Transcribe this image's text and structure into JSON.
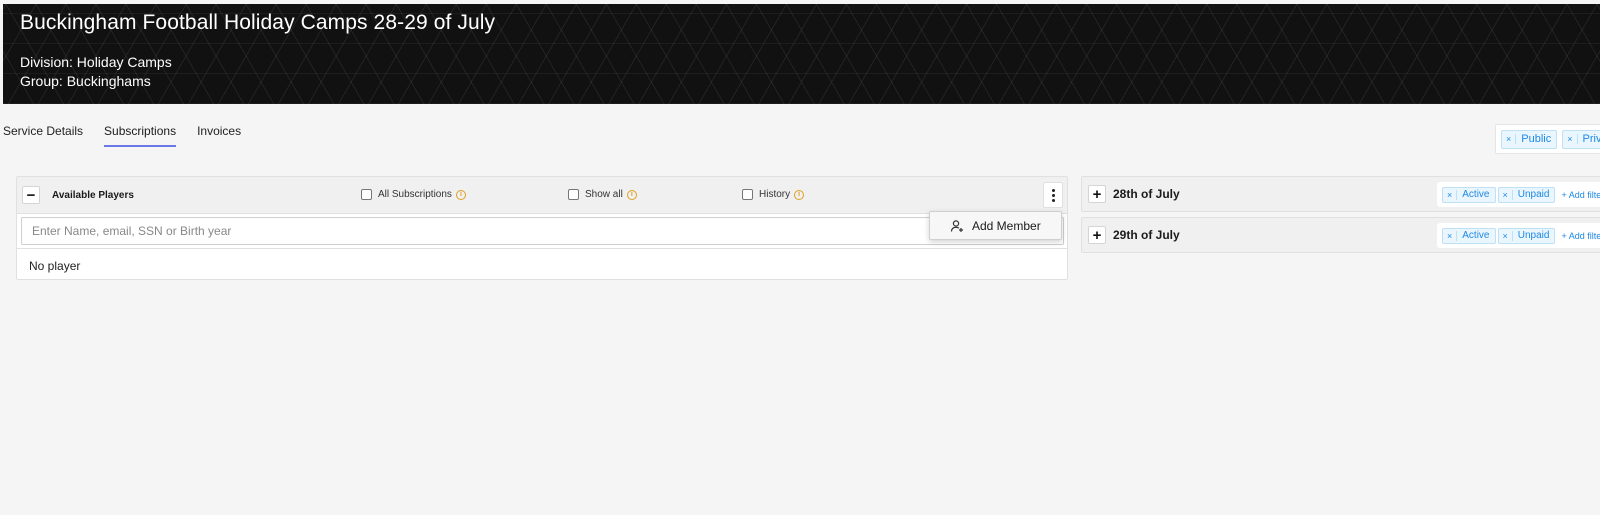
{
  "header": {
    "title": "Buckingham Football Holiday Camps 28-29 of July",
    "division": "Division: Holiday Camps",
    "group": "Group: Buckinghams"
  },
  "tabs": [
    {
      "label": "Service Details",
      "active": false
    },
    {
      "label": "Subscriptions",
      "active": true
    },
    {
      "label": "Invoices",
      "active": false
    }
  ],
  "visibility_filters": [
    {
      "remove": "×",
      "label": "Public"
    },
    {
      "remove": "×",
      "label": "Private"
    }
  ],
  "available_players": {
    "collapse_icon": "minus-icon",
    "title": "Available Players",
    "options": [
      {
        "label": "All Subscriptions",
        "checked": false
      },
      {
        "label": "Show all",
        "checked": false
      },
      {
        "label": "History",
        "checked": false
      }
    ],
    "info_glyph": "i",
    "search_placeholder": "Enter Name, email, SSN or Birth year",
    "empty_text": "No player"
  },
  "context_menu": {
    "item_label": "Add Member",
    "item_icon": "add-person-icon"
  },
  "days": [
    {
      "title": "28th of July",
      "filters": [
        {
          "remove": "×",
          "label": "Active"
        },
        {
          "remove": "×",
          "label": "Unpaid"
        }
      ],
      "add_filter": "+ Add filter"
    },
    {
      "title": "29th of July",
      "filters": [
        {
          "remove": "×",
          "label": "Active"
        },
        {
          "remove": "×",
          "label": "Unpaid"
        }
      ],
      "add_filter": "+ Add filter"
    }
  ],
  "colors": {
    "banner_bg": "#111111",
    "accent_tab": "#6b78e8",
    "chip_blue": "#1e88e5",
    "info_orange": "#e0a020"
  }
}
